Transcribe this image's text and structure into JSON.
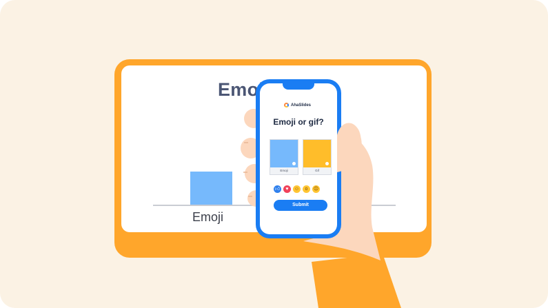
{
  "presentation": {
    "title": "Emoj",
    "bar_label": "Emoji"
  },
  "phone": {
    "brand": "AhaSlides",
    "question": "Emoji or gif?",
    "options": [
      {
        "label": "Emoji",
        "color": "#76b9fc"
      },
      {
        "label": "Gif",
        "color": "#ffbd2a"
      }
    ],
    "reactions": [
      "thumbs-up-icon",
      "heart-icon",
      "laugh-icon",
      "wow-icon",
      "sad-icon"
    ],
    "submit_label": "Submit"
  },
  "colors": {
    "background": "#fbf2e4",
    "monitor": "#ffa62b",
    "accent_blue": "#1a7df3"
  }
}
